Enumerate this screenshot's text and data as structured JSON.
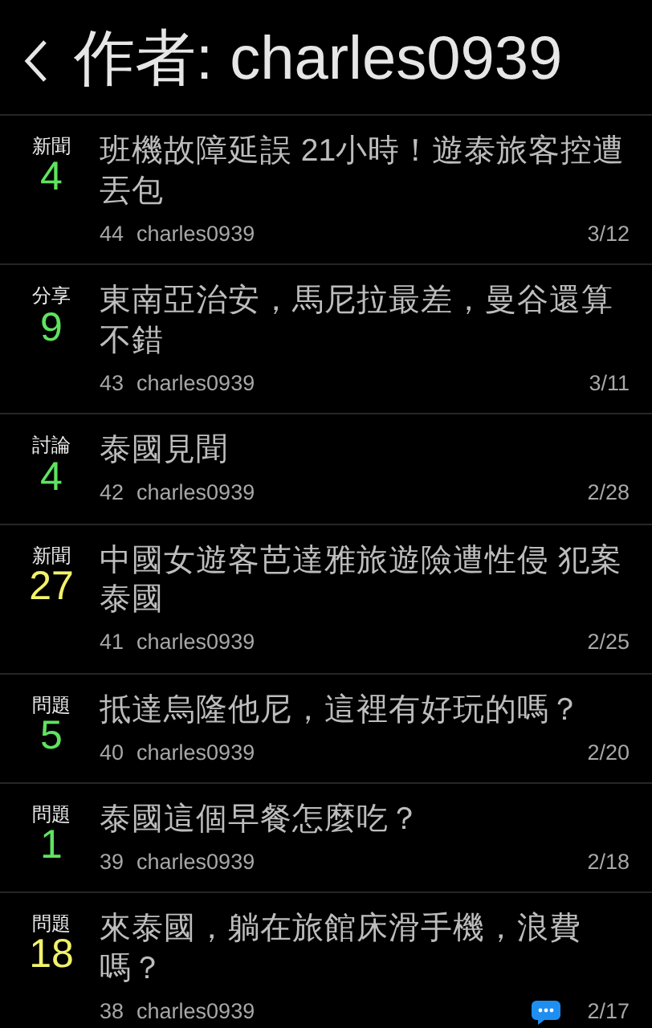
{
  "header": {
    "title": "作者: charles0939"
  },
  "posts": [
    {
      "category": "新聞",
      "count": "4",
      "color": "#5fe35f",
      "title": "班機故障延誤 21小時！遊泰旅客控遭丟包",
      "number": "44",
      "author": "charles0939",
      "date": "3/12",
      "reply_icon": false
    },
    {
      "category": "分享",
      "count": "9",
      "color": "#5fe35f",
      "title": "東南亞治安，馬尼拉最差，曼谷還算不錯",
      "number": "43",
      "author": "charles0939",
      "date": "3/11",
      "reply_icon": false
    },
    {
      "category": "討論",
      "count": "4",
      "color": "#5fe35f",
      "title": "泰國見聞",
      "number": "42",
      "author": "charles0939",
      "date": "2/28",
      "reply_icon": false
    },
    {
      "category": "新聞",
      "count": "27",
      "color": "#f2f26a",
      "title": "中國女遊客芭達雅旅遊險遭性侵 犯案泰國",
      "number": "41",
      "author": "charles0939",
      "date": "2/25",
      "reply_icon": false
    },
    {
      "category": "問題",
      "count": "5",
      "color": "#5fe35f",
      "title": "抵達烏隆他尼，這裡有好玩的嗎？",
      "number": "40",
      "author": "charles0939",
      "date": "2/20",
      "reply_icon": false
    },
    {
      "category": "問題",
      "count": "1",
      "color": "#5fe35f",
      "title": "泰國這個早餐怎麼吃？",
      "number": "39",
      "author": "charles0939",
      "date": "2/18",
      "reply_icon": false
    },
    {
      "category": "問題",
      "count": "18",
      "color": "#f2f26a",
      "title": "來泰國，躺在旅館床滑手機，浪費嗎？",
      "number": "38",
      "author": "charles0939",
      "date": "2/17",
      "reply_icon": true
    }
  ]
}
